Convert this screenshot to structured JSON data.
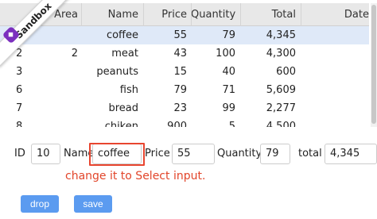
{
  "table": {
    "columns": [
      "",
      "Area",
      "Name",
      "Price",
      "Quantity",
      "Total",
      "Date"
    ],
    "rows": [
      {
        "id": "10",
        "area": "",
        "name": "coffee",
        "price": "55",
        "quantity": "79",
        "total": "4,345",
        "date": ""
      },
      {
        "id": "2",
        "area": "2",
        "name": "meat",
        "price": "43",
        "quantity": "100",
        "total": "4,300",
        "date": ""
      },
      {
        "id": "3",
        "area": "",
        "name": "peanuts",
        "price": "15",
        "quantity": "40",
        "total": "600",
        "date": ""
      },
      {
        "id": "6",
        "area": "",
        "name": "fish",
        "price": "79",
        "quantity": "71",
        "total": "5,609",
        "date": ""
      },
      {
        "id": "7",
        "area": "",
        "name": "bread",
        "price": "23",
        "quantity": "99",
        "total": "2,277",
        "date": ""
      },
      {
        "id": "8",
        "area": "",
        "name": "chiken",
        "price": "900",
        "quantity": "5",
        "total": "4,500",
        "date": ""
      }
    ],
    "selected_row": 0
  },
  "ribbon": {
    "label": "Sandbox",
    "icon": "sandbox-logo-icon",
    "color": "#7b2fbe"
  },
  "form": {
    "id_label": "ID",
    "id_value": "10",
    "name_label": "Name",
    "name_value": "coffee",
    "price_label": "Price",
    "price_value": "55",
    "quantity_label": "Quantity",
    "quantity_value": "79",
    "total_label": "total",
    "total_value": "4,345"
  },
  "annotation": {
    "note": "change it to Select input.",
    "color": "#e2452a"
  },
  "buttons": {
    "drop": "drop",
    "save": "save",
    "color": "#5b9bf0"
  }
}
